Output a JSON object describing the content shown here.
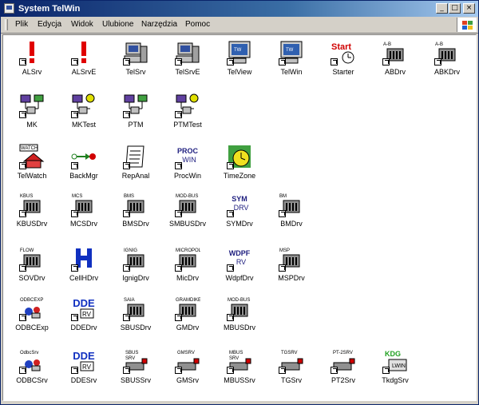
{
  "window": {
    "title": "System TelWin",
    "buttons": {
      "minimize": "_",
      "maximize": "□",
      "close": "×"
    }
  },
  "menu": [
    "Plik",
    "Edycja",
    "Widok",
    "Ulubione",
    "Narzędzia",
    "Pomoc"
  ],
  "items": [
    {
      "label": "ALSrv",
      "icon": "alert-exclamation-icon"
    },
    {
      "label": "ALSrvE",
      "icon": "alert-exclamation-icon"
    },
    {
      "label": "TelSrv",
      "icon": "server-computer-icon"
    },
    {
      "label": "TelSrvE",
      "icon": "server-computer-icon"
    },
    {
      "label": "TelView",
      "icon": "monitor-icon"
    },
    {
      "label": "TelWin",
      "icon": "monitor-icon"
    },
    {
      "label": "Starter",
      "icon": "starter-clock-icon",
      "icon_text": "Start"
    },
    {
      "label": "ABDrv",
      "icon": "driver-box-icon",
      "icon_text": "A-B"
    },
    {
      "label": "ABKDrv",
      "icon": "driver-box-icon",
      "icon_text": "A-B"
    },
    {
      "label": "MK",
      "icon": "network-computers-icon"
    },
    {
      "label": "MKTest",
      "icon": "network-test-icon"
    },
    {
      "label": "PTM",
      "icon": "network-computers-icon"
    },
    {
      "label": "PTMTest",
      "icon": "network-test-icon"
    },
    {
      "label": "TelWatch",
      "icon": "watch-house-icon",
      "icon_text": "WATCH"
    },
    {
      "label": "BackMgr",
      "icon": "backup-arrow-icon"
    },
    {
      "label": "RepAnal",
      "icon": "report-document-icon"
    },
    {
      "label": "ProcWin",
      "icon": "text-icon",
      "icon_text": "PROC WIN"
    },
    {
      "label": "TimeZone",
      "icon": "timezone-clock-icon"
    },
    {
      "label": "KBUSDrv",
      "icon": "driver-box-icon",
      "icon_text": "KBUS"
    },
    {
      "label": "MCSDrv",
      "icon": "driver-box-icon",
      "icon_text": "MCS"
    },
    {
      "label": "BMSDrv",
      "icon": "driver-box-icon",
      "icon_text": "BMS"
    },
    {
      "label": "SMBUSDrv",
      "icon": "driver-box-icon",
      "icon_text": "MOD-BUS"
    },
    {
      "label": "SYMDrv",
      "icon": "text-icon",
      "icon_text": "SYM DRV"
    },
    {
      "label": "BMDrv",
      "icon": "driver-box-icon",
      "icon_text": "BM"
    },
    {
      "label": "SOVDrv",
      "icon": "driver-box-icon",
      "icon_text": "FLOW"
    },
    {
      "label": "CellHDrv",
      "icon": "cell-h-icon"
    },
    {
      "label": "IgnigDrv",
      "icon": "driver-box-icon",
      "icon_text": "IGNIG"
    },
    {
      "label": "MicDrv",
      "icon": "driver-box-icon",
      "icon_text": "MICROPOL"
    },
    {
      "label": "WdpfDrv",
      "icon": "text-icon",
      "icon_text": "WDPF RV"
    },
    {
      "label": "MSPDrv",
      "icon": "driver-box-icon",
      "icon_text": "MSP"
    },
    {
      "label": "ODBCExp",
      "icon": "odbc-exp-icon",
      "icon_text": "ODBCEXP"
    },
    {
      "label": "DDEDrv",
      "icon": "dde-icon",
      "icon_text": "DDE"
    },
    {
      "label": "SBUSDrv",
      "icon": "driver-box-icon",
      "icon_text": "SAIA"
    },
    {
      "label": "GMDrv",
      "icon": "driver-box-icon",
      "icon_text": "GRAMDIKEN"
    },
    {
      "label": "MBUSDrv",
      "icon": "driver-box-icon",
      "icon_text": "MOD-BUS"
    },
    {
      "label": "ODBCSrv",
      "icon": "odbc-exp-icon",
      "icon_text": "OdbcSrv"
    },
    {
      "label": "DDESrv",
      "icon": "dde-icon",
      "icon_text": "DDE"
    },
    {
      "label": "SBUSSrv",
      "icon": "server-label-icon",
      "icon_text": "SBUS SRV"
    },
    {
      "label": "GMSrv",
      "icon": "server-label-icon",
      "icon_text": "GMSRV"
    },
    {
      "label": "MBUSSrv",
      "icon": "server-label-icon",
      "icon_text": "MBUS SRV"
    },
    {
      "label": "TGSrv",
      "icon": "server-label-icon",
      "icon_text": "TGSRV"
    },
    {
      "label": "PT2Srv",
      "icon": "server-label-icon",
      "icon_text": "PT-2SRV"
    },
    {
      "label": "TkdgSrv",
      "icon": "kdg-icon",
      "icon_text": "KDG"
    }
  ]
}
